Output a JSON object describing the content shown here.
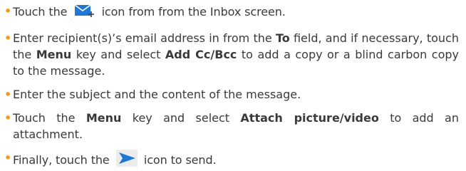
{
  "colors": {
    "bullet": "#f39a1e",
    "icon_blue": "#1e77d4",
    "text": "#3a3a3a"
  },
  "icons": {
    "compose": "compose-mail-icon",
    "send": "send-arrow-icon"
  },
  "steps": [
    {
      "bullet": "•",
      "before": "Touch the",
      "after": "icon from from the Inbox screen."
    },
    {
      "bullet": "•",
      "p1": "Enter recipient(s)’s email address in from the ",
      "b1": "To",
      "p2": " field, and if necessary, touch  the ",
      "b2": "Menu",
      "p3": " key and select ",
      "b3": "Add Cc/Bcc",
      "p4": " to add a copy or a blind carbon copy to the message."
    },
    {
      "bullet": "•",
      "text": "Enter the subject and the content of the message."
    },
    {
      "bullet": "•",
      "p1": "Touch the ",
      "b1": "Menu",
      "p2": " key and select ",
      "b2": "Attach picture/video",
      "p3": " to add an attachment."
    },
    {
      "bullet": "•",
      "before": "Finally, touch the",
      "after": "icon to send."
    }
  ]
}
